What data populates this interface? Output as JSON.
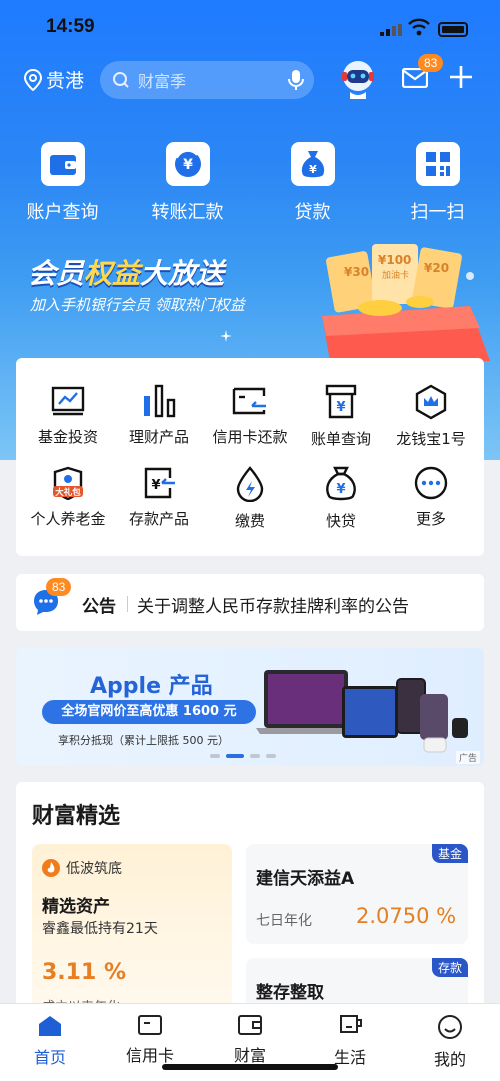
{
  "status": {
    "time": "14:59"
  },
  "topbar": {
    "location": "贵港",
    "search_placeholder": "财富季",
    "mail_badge": "83"
  },
  "main_icons": [
    {
      "label": "账户查询",
      "icon": "wallet-icon"
    },
    {
      "label": "转账汇款",
      "icon": "transfer-icon"
    },
    {
      "label": "贷款",
      "icon": "money-bag-icon"
    },
    {
      "label": "扫一扫",
      "icon": "scan-icon"
    }
  ],
  "promo": {
    "title_a": "会员",
    "title_b": "权益",
    "title_c": "大放送",
    "subtitle": "加入手机银行会员 领取热门权益",
    "coupon1": "¥30",
    "coupon2": "¥100",
    "coupon2_sub": "加油卡",
    "coupon3": "¥20"
  },
  "services": [
    {
      "label": "基金投资",
      "icon": "chart-board-icon"
    },
    {
      "label": "理财产品",
      "icon": "bar-chart-icon"
    },
    {
      "label": "信用卡还款",
      "icon": "card-icon"
    },
    {
      "label": "账单查询",
      "icon": "bill-icon"
    },
    {
      "label": "龙钱宝1号",
      "icon": "crown-shield-icon"
    },
    {
      "label": "个人养老金",
      "icon": "pension-icon",
      "tag": "大礼包"
    },
    {
      "label": "存款产品",
      "icon": "deposit-icon"
    },
    {
      "label": "缴费",
      "icon": "drop-bolt-icon"
    },
    {
      "label": "快贷",
      "icon": "quick-loan-icon"
    },
    {
      "label": "更多",
      "icon": "more-icon"
    }
  ],
  "announcement": {
    "badge": "83",
    "label": "公告",
    "text": "关于调整人民币存款挂牌利率的公告"
  },
  "ad": {
    "title": "Apple 产品",
    "highlight": "全场官网价至高优惠 1600 元",
    "note": "享积分抵现（累计上限抵 500 元）",
    "tag": "广告"
  },
  "wealth": {
    "title": "财富精选",
    "left": {
      "tag": "低波筑底",
      "name": "精选资产",
      "desc": "睿鑫最低持有21天",
      "rate": "3.11 %",
      "rate_label": "成立以来年化"
    },
    "right1": {
      "badge": "基金",
      "name": "建信天添益A",
      "label": "七日年化",
      "value": "2.0750 %"
    },
    "right2": {
      "badge": "存款",
      "name": "整存整取"
    }
  },
  "nav": [
    {
      "label": "首页",
      "icon": "home-icon",
      "active": true
    },
    {
      "label": "信用卡",
      "icon": "credit-card-icon"
    },
    {
      "label": "财富",
      "icon": "wallet-icon"
    },
    {
      "label": "生活",
      "icon": "cup-icon"
    },
    {
      "label": "我的",
      "icon": "smile-icon"
    }
  ],
  "colors": {
    "brand": "#1f6fe8",
    "accent": "#ff8a1f",
    "rate": "#e67e22"
  }
}
